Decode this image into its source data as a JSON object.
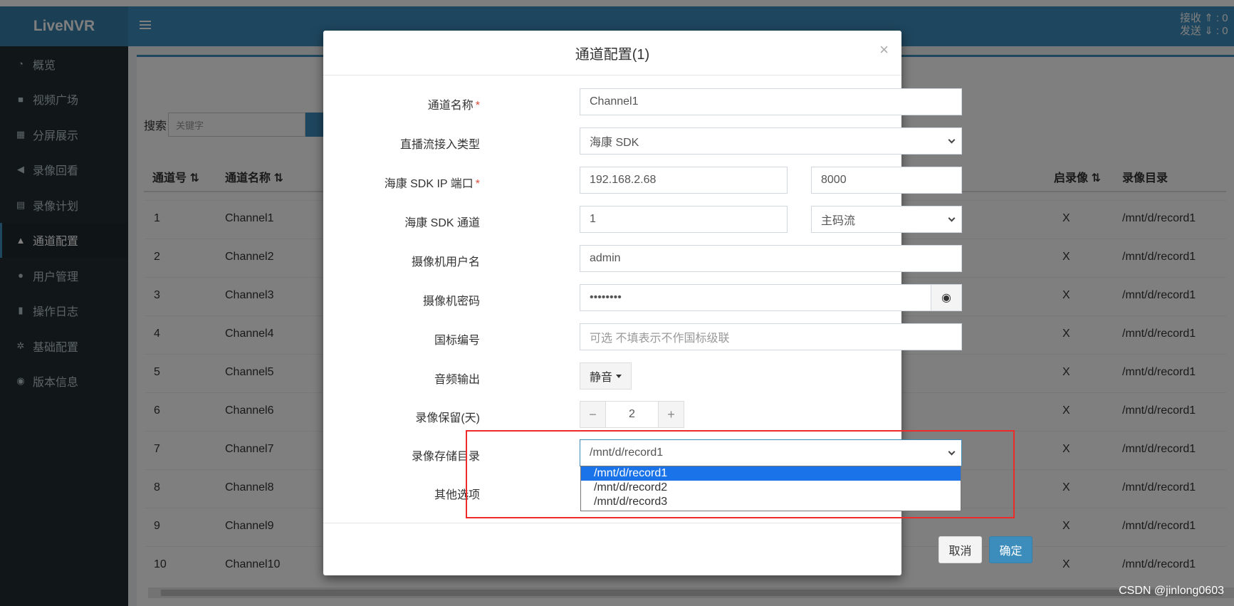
{
  "app": {
    "logo": "LiveNVR"
  },
  "net_stats": {
    "recv_label": "接收",
    "recv_value": "0",
    "send_label": "发送",
    "send_value": "0"
  },
  "sidebar": {
    "items": [
      {
        "label": "概览",
        "icon": "dashboard-icon",
        "glyph": "◔"
      },
      {
        "label": "视频广场",
        "icon": "video-camera-icon",
        "glyph": "■"
      },
      {
        "label": "分屏展示",
        "icon": "grid-icon",
        "glyph": "▦"
      },
      {
        "label": "录像回看",
        "icon": "backward-icon",
        "glyph": "◀"
      },
      {
        "label": "录像计划",
        "icon": "calendar-icon",
        "glyph": "▤"
      },
      {
        "label": "通道配置",
        "icon": "sitemap-icon",
        "glyph": "▲"
      },
      {
        "label": "用户管理",
        "icon": "users-icon",
        "glyph": "●"
      },
      {
        "label": "操作日志",
        "icon": "file-icon",
        "glyph": "▮"
      },
      {
        "label": "基础配置",
        "icon": "cogs-icon",
        "glyph": "✲"
      },
      {
        "label": "版本信息",
        "icon": "support-icon",
        "glyph": "◉"
      }
    ]
  },
  "search": {
    "label": "搜索",
    "placeholder": "关键字"
  },
  "table": {
    "headers": [
      "通道号",
      "通道名称",
      "启录像",
      "录像目录"
    ],
    "rows": [
      {
        "id": "1",
        "name": "Channel1",
        "rec": "X",
        "dir": "/mnt/d/record1"
      },
      {
        "id": "2",
        "name": "Channel2",
        "rec": "X",
        "dir": "/mnt/d/record1"
      },
      {
        "id": "3",
        "name": "Channel3",
        "rec": "X",
        "dir": "/mnt/d/record1"
      },
      {
        "id": "4",
        "name": "Channel4",
        "rec": "X",
        "dir": "/mnt/d/record1"
      },
      {
        "id": "5",
        "name": "Channel5",
        "rec": "X",
        "dir": "/mnt/d/record1"
      },
      {
        "id": "6",
        "name": "Channel6",
        "rec": "X",
        "dir": "/mnt/d/record1"
      },
      {
        "id": "7",
        "name": "Channel7",
        "rec": "X",
        "dir": "/mnt/d/record1"
      },
      {
        "id": "8",
        "name": "Channel8",
        "rec": "X",
        "dir": "/mnt/d/record1"
      },
      {
        "id": "9",
        "name": "Channel9",
        "rec": "X",
        "dir": "/mnt/d/record1"
      },
      {
        "id": "10",
        "name": "Channel10",
        "rec": "X",
        "dir": "/mnt/d/record1"
      }
    ]
  },
  "modal": {
    "title": "通道配置(1)",
    "close": "×",
    "fields": {
      "channel_name": {
        "label": "通道名称",
        "value": "Channel1"
      },
      "stream_type": {
        "label": "直播流接入类型",
        "value": "海康 SDK"
      },
      "sdk_ip_port": {
        "label": "海康 SDK IP 端口",
        "ip": "192.168.2.68",
        "port": "8000"
      },
      "sdk_channel": {
        "label": "海康 SDK 通道",
        "value": "1",
        "stream": "主码流"
      },
      "camera_user": {
        "label": "摄像机用户名",
        "value": "admin"
      },
      "camera_pass": {
        "label": "摄像机密码",
        "value": "••••••••"
      },
      "gb_code": {
        "label": "国标编号",
        "placeholder": "可选 不填表示不作国标级联"
      },
      "audio": {
        "label": "音频输出",
        "value": "静音"
      },
      "retention": {
        "label": "录像保留(天)",
        "value": "2",
        "minus": "−",
        "plus": "+"
      },
      "storage_dir": {
        "label": "录像存储目录",
        "value": "/mnt/d/record1",
        "options": [
          "/mnt/d/record1",
          "/mnt/d/record2",
          "/mnt/d/record3"
        ]
      },
      "other": {
        "label": "其他选项"
      }
    },
    "required_mark": "*",
    "buttons": {
      "cancel": "取消",
      "ok": "确定"
    }
  },
  "watermark": "CSDN @jinlong0603"
}
